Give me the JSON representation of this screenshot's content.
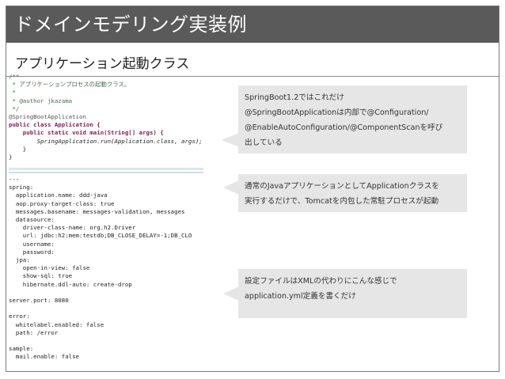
{
  "slide": {
    "title": "ドメインモデリング実装例",
    "subtitle": "アプリケーション起動クラス"
  },
  "java_code": [
    "/**",
    " * アプリケーションプロセスの起動クラス。",
    " *",
    " * @author jkazama",
    " */",
    "@SpringBootApplication",
    "public class Application {",
    "    public static void main(String[] args) {",
    "        SpringApplication.run(Application.class, args);",
    "    }",
    "}"
  ],
  "yaml_code": [
    "---",
    "spring:",
    "  application.name: ddd-java",
    "  aop.proxy-target-class: true",
    "  messages.basename: messages-validation, messages",
    "  datasource:",
    "    driver-class-name: org.h2.Driver",
    "    url: jdbc:h2:mem:testdb;DB_CLOSE_DELAY=-1;DB_CLO",
    "    username:",
    "    password:",
    "  jpa:",
    "    open-in-view: false",
    "    show-sql: true",
    "    hibernate.ddl-auto: create-drop",
    "",
    "server.port: 8080",
    "",
    "error:",
    "  whitelabel.enabled: false",
    "  path: /error",
    "",
    "sample:",
    "  mail.enable: false"
  ],
  "callouts": [
    {
      "lines": [
        "SpringBoot1.2ではこれだけ",
        "@SpringBootApplicationは内部で@Configuration/",
        "@EnableAutoConfiguration/@ComponentScanを呼び",
        "出している"
      ]
    },
    {
      "lines": [
        "通常のJavaアプリケーションとしてApplicationクラスを",
        "実行するだけで、Tomcatを内包した常駐プロセスが起動"
      ]
    },
    {
      "lines": [
        "設定ファイルはXMLの代わりにこんな感じで",
        "application.yml定義を書くだけ"
      ]
    }
  ],
  "colors": {
    "title_bar": "#5a5a5a",
    "callout_bg": "#e6e6e6",
    "comment": "#3f6e46",
    "keyword": "#7a1f55"
  }
}
